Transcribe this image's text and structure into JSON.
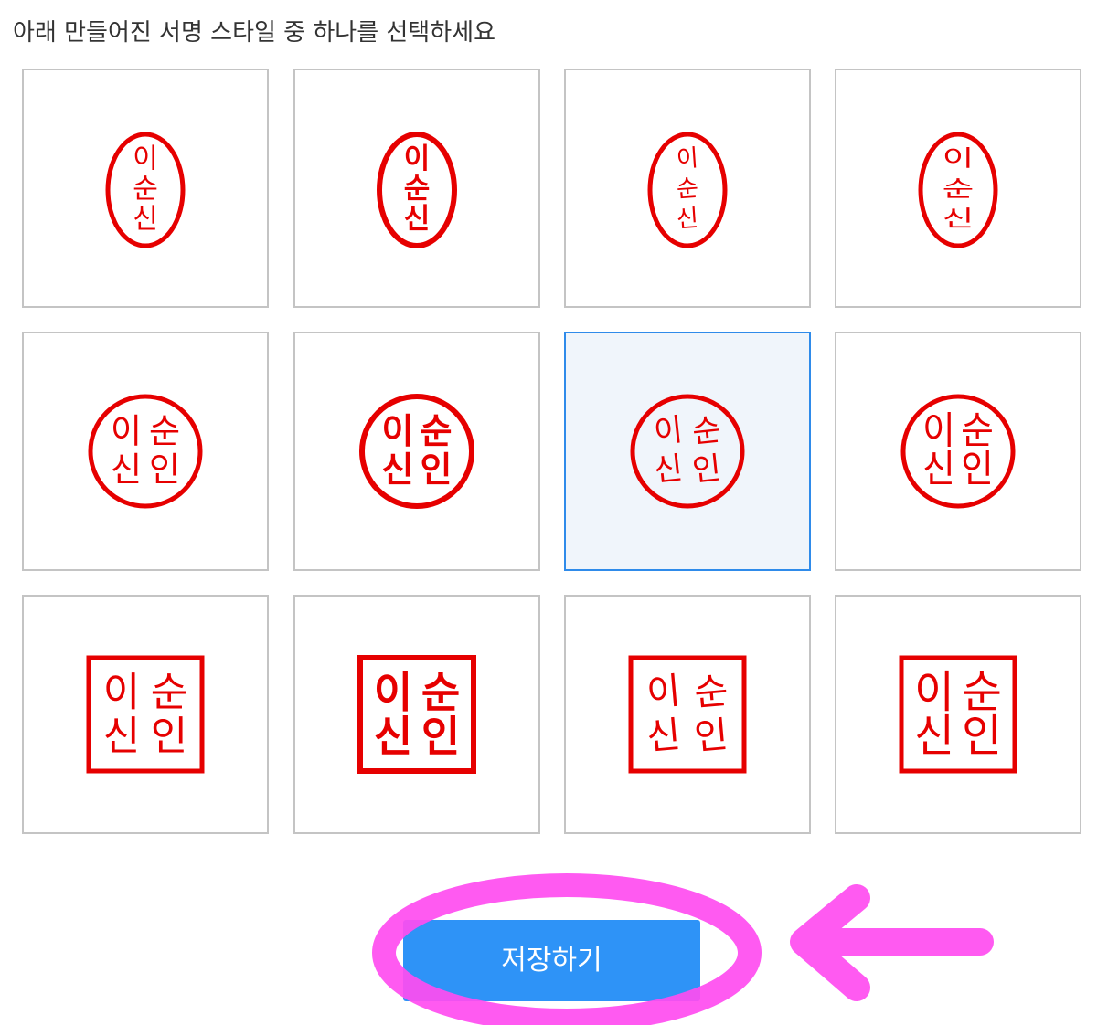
{
  "instruction": "아래 만들어진 서명 스타일 중 하나를 선택하세요",
  "name_chars": [
    "이",
    "순",
    "신",
    "인"
  ],
  "stamp_color": "#e60000",
  "accent_color": "#2e93f7",
  "highlight_color": "#ff4cf0",
  "selected_index": 6,
  "stamps": [
    {
      "shape": "oval",
      "style": "regular",
      "chars": [
        "이",
        "순",
        "신"
      ]
    },
    {
      "shape": "oval",
      "style": "bold",
      "chars": [
        "이",
        "순",
        "신"
      ]
    },
    {
      "shape": "oval",
      "style": "brush",
      "chars": [
        "이",
        "순",
        "신"
      ]
    },
    {
      "shape": "oval",
      "style": "seal-script",
      "chars": [
        "이",
        "순",
        "신"
      ]
    },
    {
      "shape": "circle",
      "style": "regular",
      "chars": [
        "이",
        "순",
        "신",
        "인"
      ]
    },
    {
      "shape": "circle",
      "style": "bold",
      "chars": [
        "이",
        "순",
        "신",
        "인"
      ]
    },
    {
      "shape": "circle",
      "style": "brush",
      "chars": [
        "이",
        "순",
        "신",
        "인"
      ]
    },
    {
      "shape": "circle",
      "style": "seal-script",
      "chars": [
        "이",
        "순",
        "신",
        "인"
      ]
    },
    {
      "shape": "square",
      "style": "regular",
      "chars": [
        "이",
        "순",
        "신",
        "인"
      ]
    },
    {
      "shape": "square",
      "style": "bold",
      "chars": [
        "이",
        "순",
        "신",
        "인"
      ]
    },
    {
      "shape": "square",
      "style": "brush",
      "chars": [
        "이",
        "순",
        "신",
        "인"
      ]
    },
    {
      "shape": "square",
      "style": "seal-script",
      "chars": [
        "이",
        "순",
        "신",
        "인"
      ]
    }
  ],
  "save_button": {
    "label": "저장하기"
  }
}
